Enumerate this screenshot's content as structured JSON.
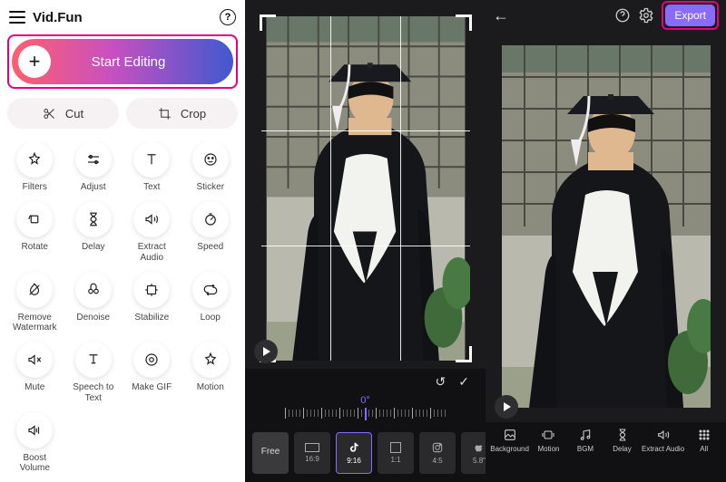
{
  "brand": "Vid.Fun",
  "help_symbol": "?",
  "start_editing_label": "Start Editing",
  "pills": {
    "cut": "Cut",
    "crop": "Crop"
  },
  "tools": [
    {
      "id": "filters",
      "label": "Filters"
    },
    {
      "id": "adjust",
      "label": "Adjust"
    },
    {
      "id": "text",
      "label": "Text"
    },
    {
      "id": "sticker",
      "label": "Sticker"
    },
    {
      "id": "rotate",
      "label": "Rotate"
    },
    {
      "id": "delay",
      "label": "Delay"
    },
    {
      "id": "extract-audio",
      "label": "Extract Audio"
    },
    {
      "id": "speed",
      "label": "Speed"
    },
    {
      "id": "remove-watermark",
      "label": "Remove Watermark"
    },
    {
      "id": "denoise",
      "label": "Denoise"
    },
    {
      "id": "stabilize",
      "label": "Stabilize"
    },
    {
      "id": "loop",
      "label": "Loop"
    },
    {
      "id": "mute",
      "label": "Mute"
    },
    {
      "id": "speech-to-text",
      "label": "Speech to Text"
    },
    {
      "id": "make-gif",
      "label": "Make GIF"
    },
    {
      "id": "motion",
      "label": "Motion"
    },
    {
      "id": "boost-volume",
      "label": "Boost Volume"
    }
  ],
  "mid": {
    "rotation_label": "0°",
    "ratios": [
      {
        "id": "free",
        "label": "Free",
        "sub": ""
      },
      {
        "id": "16-9",
        "label": "",
        "sub": "16:9"
      },
      {
        "id": "tiktok",
        "label": "",
        "sub": "9:16"
      },
      {
        "id": "1-1",
        "label": "",
        "sub": "1:1"
      },
      {
        "id": "ig",
        "label": "",
        "sub": "4:5"
      },
      {
        "id": "apple",
        "label": "",
        "sub": "5.8\""
      }
    ],
    "active_ratio_index": 2
  },
  "right": {
    "export_label": "Export",
    "toolbar": [
      {
        "id": "background",
        "label": "Background"
      },
      {
        "id": "motion",
        "label": "Motion"
      },
      {
        "id": "bgm",
        "label": "BGM"
      },
      {
        "id": "delay",
        "label": "Delay"
      },
      {
        "id": "extract-audio",
        "label": "Extract Audio"
      },
      {
        "id": "all",
        "label": "All"
      }
    ]
  },
  "colors": {
    "accent": "#8a6bff",
    "highlight": "#e6007e"
  }
}
